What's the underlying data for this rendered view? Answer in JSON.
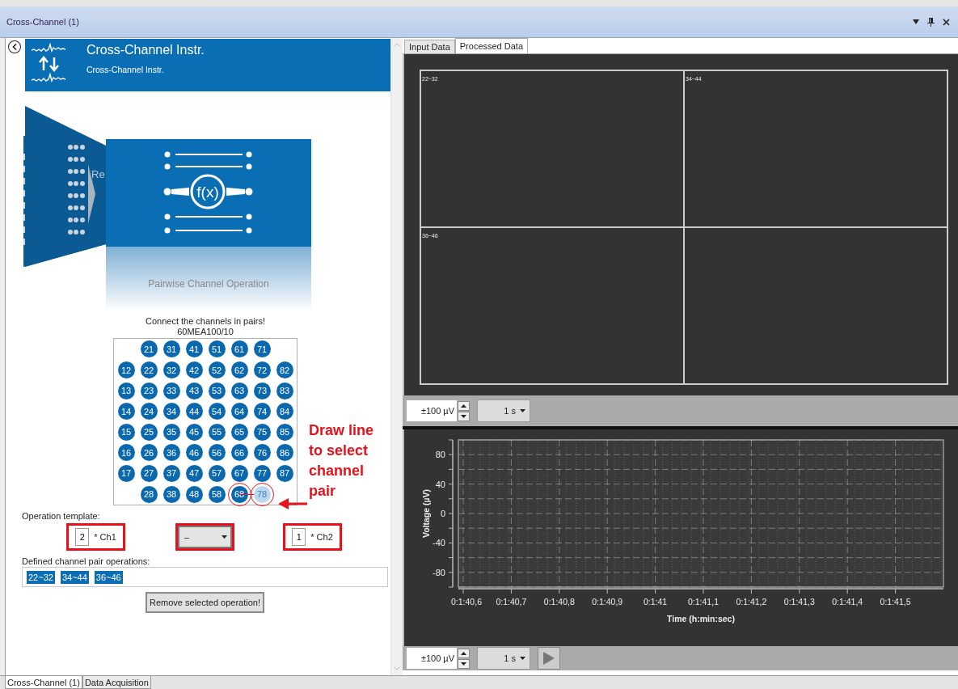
{
  "window": {
    "title": "Cross-Channel (1)"
  },
  "module": {
    "title": "Cross-Channel Instr.",
    "subtitle": "Cross-Channel Instr.",
    "illustration": {
      "back_label": "Re",
      "symbol": "f(x)",
      "caption": "Pairwise Channel Operation"
    }
  },
  "electrode_grid": {
    "instruction": "Connect the channels in pairs!",
    "layout": "60MEA100/10",
    "rows": [
      [
        {
          "label": "21",
          "highlighted": false,
          "circled": false
        },
        {
          "label": "31",
          "highlighted": false,
          "circled": false
        },
        {
          "label": "41",
          "highlighted": false,
          "circled": false
        },
        {
          "label": "51",
          "highlighted": false,
          "circled": false
        },
        {
          "label": "61",
          "highlighted": false,
          "circled": false
        },
        {
          "label": "71",
          "highlighted": false,
          "circled": false
        }
      ],
      [
        {
          "label": "12",
          "highlighted": false,
          "circled": false
        },
        {
          "label": "22",
          "highlighted": false,
          "circled": false
        },
        {
          "label": "32",
          "highlighted": false,
          "circled": false
        },
        {
          "label": "42",
          "highlighted": false,
          "circled": false
        },
        {
          "label": "52",
          "highlighted": false,
          "circled": false
        },
        {
          "label": "62",
          "highlighted": false,
          "circled": false
        },
        {
          "label": "72",
          "highlighted": false,
          "circled": false
        },
        {
          "label": "82",
          "highlighted": false,
          "circled": false
        }
      ],
      [
        {
          "label": "13",
          "highlighted": false,
          "circled": false
        },
        {
          "label": "23",
          "highlighted": false,
          "circled": false
        },
        {
          "label": "33",
          "highlighted": false,
          "circled": false
        },
        {
          "label": "43",
          "highlighted": false,
          "circled": false
        },
        {
          "label": "53",
          "highlighted": false,
          "circled": false
        },
        {
          "label": "63",
          "highlighted": false,
          "circled": false
        },
        {
          "label": "73",
          "highlighted": false,
          "circled": false
        },
        {
          "label": "83",
          "highlighted": false,
          "circled": false
        }
      ],
      [
        {
          "label": "14",
          "highlighted": false,
          "circled": false
        },
        {
          "label": "24",
          "highlighted": false,
          "circled": false
        },
        {
          "label": "34",
          "highlighted": false,
          "circled": false
        },
        {
          "label": "44",
          "highlighted": false,
          "circled": false
        },
        {
          "label": "54",
          "highlighted": false,
          "circled": false
        },
        {
          "label": "64",
          "highlighted": false,
          "circled": false
        },
        {
          "label": "74",
          "highlighted": false,
          "circled": false
        },
        {
          "label": "84",
          "highlighted": false,
          "circled": false
        }
      ],
      [
        {
          "label": "15",
          "highlighted": false,
          "circled": false
        },
        {
          "label": "25",
          "highlighted": false,
          "circled": false
        },
        {
          "label": "35",
          "highlighted": false,
          "circled": false
        },
        {
          "label": "45",
          "highlighted": false,
          "circled": false
        },
        {
          "label": "55",
          "highlighted": false,
          "circled": false
        },
        {
          "label": "65",
          "highlighted": false,
          "circled": false
        },
        {
          "label": "75",
          "highlighted": false,
          "circled": false
        },
        {
          "label": "85",
          "highlighted": false,
          "circled": false
        }
      ],
      [
        {
          "label": "16",
          "highlighted": false,
          "circled": false
        },
        {
          "label": "26",
          "highlighted": false,
          "circled": false
        },
        {
          "label": "36",
          "highlighted": false,
          "circled": false
        },
        {
          "label": "46",
          "highlighted": false,
          "circled": false
        },
        {
          "label": "56",
          "highlighted": false,
          "circled": false
        },
        {
          "label": "66",
          "highlighted": false,
          "circled": false
        },
        {
          "label": "76",
          "highlighted": false,
          "circled": false
        },
        {
          "label": "86",
          "highlighted": false,
          "circled": false
        }
      ],
      [
        {
          "label": "17",
          "highlighted": false,
          "circled": false
        },
        {
          "label": "27",
          "highlighted": false,
          "circled": false
        },
        {
          "label": "37",
          "highlighted": false,
          "circled": false
        },
        {
          "label": "47",
          "highlighted": false,
          "circled": false
        },
        {
          "label": "57",
          "highlighted": false,
          "circled": false
        },
        {
          "label": "67",
          "highlighted": false,
          "circled": false
        },
        {
          "label": "77",
          "highlighted": false,
          "circled": false
        },
        {
          "label": "87",
          "highlighted": false,
          "circled": false
        }
      ],
      [
        {
          "label": "28",
          "highlighted": false,
          "circled": false
        },
        {
          "label": "38",
          "highlighted": false,
          "circled": false
        },
        {
          "label": "48",
          "highlighted": false,
          "circled": false
        },
        {
          "label": "58",
          "highlighted": false,
          "circled": false
        },
        {
          "label": "68",
          "highlighted": false,
          "circled": true,
          "line_to_next": true
        },
        {
          "label": "78",
          "highlighted": true,
          "circled": true
        }
      ]
    ]
  },
  "annotation": {
    "lines": [
      "Draw line",
      "to select",
      "channel",
      "pair"
    ]
  },
  "operation_template": {
    "label": "Operation template:",
    "ch1": {
      "factor": "2",
      "label": "* Ch1",
      "highlighted": true
    },
    "operator": {
      "value": "–",
      "highlighted": true
    },
    "ch2": {
      "factor": "1",
      "label": "* Ch2",
      "highlighted": true
    }
  },
  "defined_operations": {
    "label": "Defined channel pair operations:",
    "items": [
      {
        "label": "22~32",
        "selected": true
      },
      {
        "label": "34~44",
        "selected": true
      },
      {
        "label": "36~46",
        "selected": true
      }
    ]
  },
  "remove_button": "Remove selected operation!",
  "right_tabs": [
    {
      "label": "Input Data",
      "selected": false
    },
    {
      "label": "Processed Data",
      "selected": true
    }
  ],
  "plot_grid": {
    "panels": [
      "22~32",
      "34~44",
      "36~46"
    ]
  },
  "top_toolbar": {
    "range": "±100 µV",
    "duration": "1 s"
  },
  "chart": {
    "chart_data": {
      "type": "line",
      "xlabel": "Time (h:min:sec)",
      "ylabel": "Voltage (µV)",
      "ylim": [
        -100,
        100
      ],
      "grid": true,
      "categories": [
        "0:1:40,6",
        "0:1:40,7",
        "0:1:40,8",
        "0:1:40,9",
        "0:1:41",
        "0:1:41,1",
        "0:1:41,2",
        "0:1:41,3",
        "0:1:41,4",
        "0:1:41,5"
      ],
      "yticks": [
        80,
        40,
        0,
        -40,
        -80
      ]
    }
  },
  "bottom_toolbar": {
    "range": "±100 µV",
    "duration": "1 s"
  },
  "bottom_tabs": [
    {
      "label": "Cross-Channel (1)",
      "selected": true
    },
    {
      "label": "Data Acquisition",
      "selected": false
    }
  ]
}
